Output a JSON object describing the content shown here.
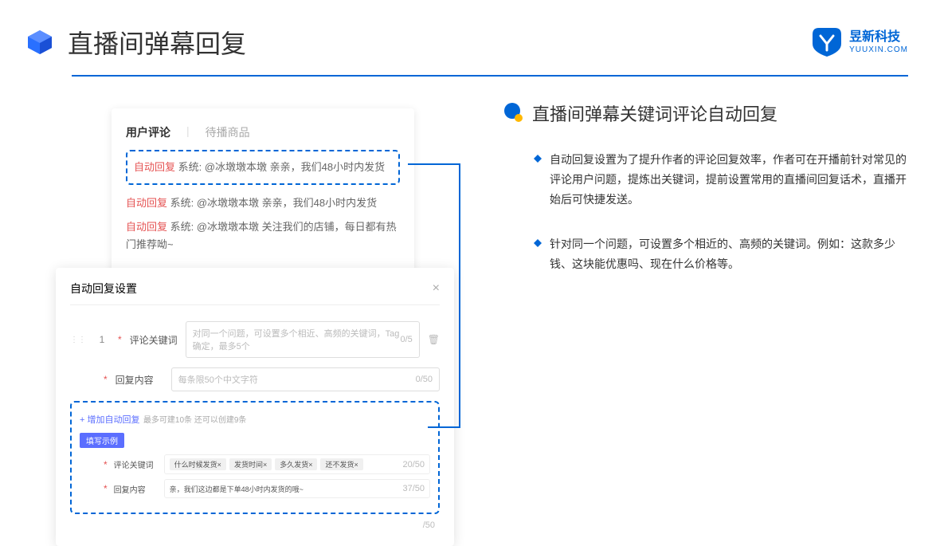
{
  "header": {
    "title": "直播间弹幕回复",
    "brand_name": "昱新科技",
    "brand_url": "YUUXIN.COM"
  },
  "card1": {
    "tab_active": "用户评论",
    "tab_inactive": "待播商品",
    "highlight_tag": "自动回复",
    "highlight_text": "系统: @冰墩墩本墩 亲亲，我们48小时内发货",
    "row2_tag": "自动回复",
    "row2_text": "系统: @冰墩墩本墩 亲亲，我们48小时内发货",
    "row3_tag": "自动回复",
    "row3_text": "系统: @冰墩墩本墩 关注我们的店铺，每日都有热门推荐呦~"
  },
  "card2": {
    "title": "自动回复设置",
    "row_num": "1",
    "kw_label": "评论关键词",
    "kw_placeholder": "对同一个问题，可设置多个相近、高频的关键词，Tag确定，最多5个",
    "kw_counter": "0/5",
    "content_label": "回复内容",
    "content_placeholder": "每条限50个中文字符",
    "content_counter": "0/50",
    "add_link": "+ 增加自动回复",
    "add_note": "最多可建10条 还可以创建9条",
    "ex_badge": "填写示例",
    "ex_kw_label": "评论关键词",
    "ex_tags": [
      "什么时候发货×",
      "发货时间×",
      "多久发货×",
      "还不发货×"
    ],
    "ex_kw_counter": "20/50",
    "ex_content_label": "回复内容",
    "ex_content_text": "亲，我们这边都是下单48小时内发货的哦~",
    "ex_content_counter": "37/50",
    "outer_counter": "/50"
  },
  "right": {
    "section_title": "直播间弹幕关键词评论自动回复",
    "bullet1": "自动回复设置为了提升作者的评论回复效率，作者可在开播前针对常见的评论用户问题，提炼出关键词，提前设置常用的直播间回复话术，直播开始后可快捷发送。",
    "bullet2": "针对同一个问题，可设置多个相近的、高频的关键词。例如：这款多少钱、这块能优惠吗、现在什么价格等。"
  }
}
